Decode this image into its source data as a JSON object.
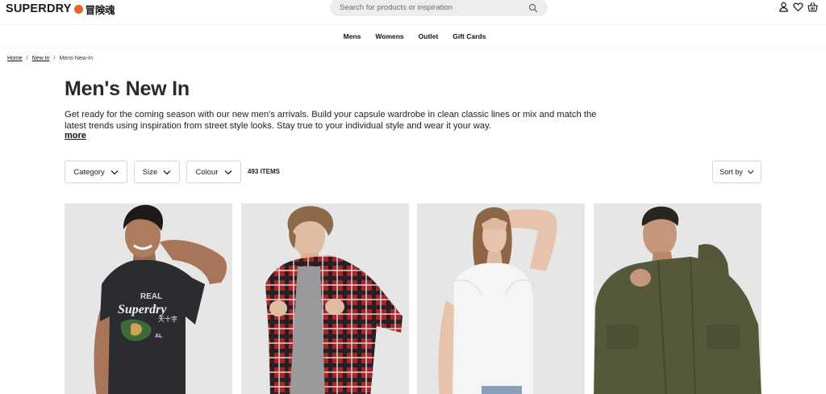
{
  "header": {
    "logo_text": "SUPERDRY",
    "logo_jp": "冒険魂",
    "search_placeholder": "Search for products or inspiration"
  },
  "nav": {
    "items": [
      "Mens",
      "Womens",
      "Outlet",
      "Gift Cards"
    ]
  },
  "breadcrumb": {
    "home": "Home",
    "new_in": "New In",
    "current": "Mens-New-In",
    "separator": "/"
  },
  "page": {
    "title": "Men's New In",
    "description": "Get ready for the coming season with our new men's arrivals. Build your capsule wardrobe in clean classic lines or mix and match the latest trends using inspiration from street style looks. Stay true to your individual style and wear it your way.",
    "more_label": "more"
  },
  "filters": {
    "category_label": "Category",
    "size_label": "Size",
    "colour_label": "Colour",
    "items_count": "493 ITEMS",
    "sort_label": "Sort by"
  },
  "products": [
    {
      "tee_text_1": "REAL",
      "tee_text_2": "Superdry",
      "tee_text_3": "天十字",
      "tee_text_4": "AL"
    },
    {},
    {},
    {}
  ],
  "colors": {
    "logo_accent": "#e8632b",
    "product_bg": "#e6e6e6"
  }
}
